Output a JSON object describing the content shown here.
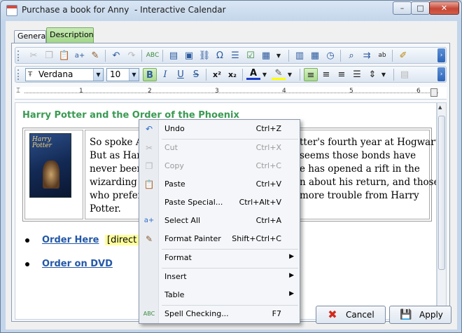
{
  "window": {
    "title": "Purchase a book for Anny  - Interactive Calendar",
    "minimize_glyph": "–",
    "maximize_glyph": "□",
    "close_glyph": "✕"
  },
  "tabs": [
    {
      "label": "General",
      "active": false
    },
    {
      "label": "Description",
      "active": true
    }
  ],
  "toolbar2": {
    "font_name": "Verdana",
    "font_size": "10",
    "bold_label": "B",
    "italic_label": "I",
    "underline_label": "U",
    "strike_label": "S",
    "superscript_label": "x²",
    "subscript_label": "x₂",
    "font_color_label": "A"
  },
  "ruler": {
    "ticks": [
      "1",
      "2",
      "3",
      "4",
      "5",
      "6"
    ]
  },
  "document": {
    "title_visible": "Harry Potter and the Order of the Phoenix",
    "book_cover_text": "Harry Potter",
    "paragraph_lines": [
      "So spoke Alb",
      "But as Harry",
      "never been m",
      "wizarding wo",
      "who prefer to",
      "Potter."
    ],
    "paragraph_right": [
      "tter's fourth year at Hogwarts.",
      "seems those bonds have",
      "e has opened a rift in the",
      "n about his return, and those",
      "more trouble from Harry"
    ],
    "links": [
      {
        "label": "Order Here",
        "note": "[direct li"
      },
      {
        "label": "Order on DVD",
        "note": ""
      }
    ]
  },
  "buttons": {
    "cancel": "Cancel",
    "apply": "Apply"
  },
  "context_menu": {
    "items": [
      {
        "label": "Undo",
        "shortcut": "Ctrl+Z",
        "icon": "undo-icon",
        "enabled": true
      },
      {
        "label": "Cut",
        "shortcut": "Ctrl+X",
        "icon": "cut-icon",
        "enabled": false
      },
      {
        "label": "Copy",
        "shortcut": "Ctrl+C",
        "icon": "copy-icon",
        "enabled": false
      },
      {
        "label": "Paste",
        "shortcut": "Ctrl+V",
        "icon": "paste-icon",
        "enabled": true
      },
      {
        "label": "Paste Special...",
        "shortcut": "Ctrl+Alt+V",
        "icon": "",
        "enabled": true
      },
      {
        "label": "Select All",
        "shortcut": "Ctrl+A",
        "icon": "select-all-icon",
        "enabled": true
      },
      {
        "label": "Format Painter",
        "shortcut": "Shift+Ctrl+C",
        "icon": "format-painter-icon",
        "enabled": true
      },
      {
        "label": "Format",
        "shortcut": "",
        "icon": "",
        "enabled": true,
        "submenu": true
      },
      {
        "label": "Insert",
        "shortcut": "",
        "icon": "",
        "enabled": true,
        "submenu": true
      },
      {
        "label": "Table",
        "shortcut": "",
        "icon": "",
        "enabled": true,
        "submenu": true
      },
      {
        "label": "Spell Checking...",
        "shortcut": "F7",
        "icon": "spell-check-icon",
        "enabled": true
      }
    ]
  },
  "colors": {
    "title_green": "#3a9a53",
    "link_blue": "#2458a8",
    "highlight": "#ffff9c"
  }
}
